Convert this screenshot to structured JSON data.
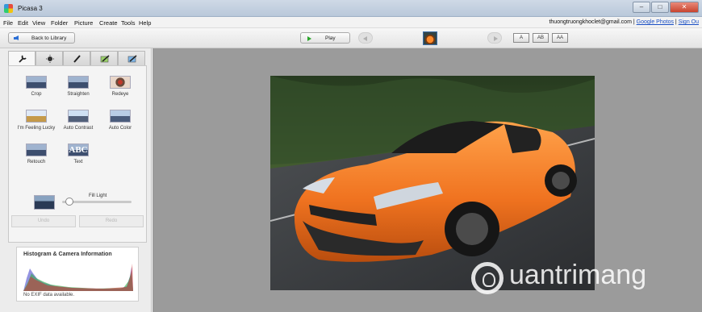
{
  "window": {
    "title": "Picasa 3"
  },
  "menu": [
    "File",
    "Edit",
    "View",
    "Folder",
    "Picture",
    "Create",
    "Tools",
    "Help"
  ],
  "account": {
    "email": "thuongtruongkhoclet@gmail.com",
    "separator": "|",
    "google_photos": "Google Photos",
    "sign_out": "Sign Ou"
  },
  "toolbar": {
    "back_label": "Back to Library",
    "play_label": "Play",
    "caption_buttons": [
      "A",
      "AB",
      "AA"
    ]
  },
  "tools": {
    "items": [
      {
        "label": "Crop"
      },
      {
        "label": "Straighten"
      },
      {
        "label": "Redeye"
      },
      {
        "label": "I'm Feeling Lucky"
      },
      {
        "label": "Auto Contrast"
      },
      {
        "label": "Auto Color"
      },
      {
        "label": "Retouch"
      },
      {
        "label": "Text"
      }
    ],
    "fill_light_label": "Fill Light",
    "fill_light_value": 0.05,
    "undo_label": "Undo",
    "redo_label": "Redo"
  },
  "histogram": {
    "title": "Histogram & Camera Information",
    "note": "No EXIF data available."
  },
  "watermark": {
    "text": "uantrimang"
  }
}
